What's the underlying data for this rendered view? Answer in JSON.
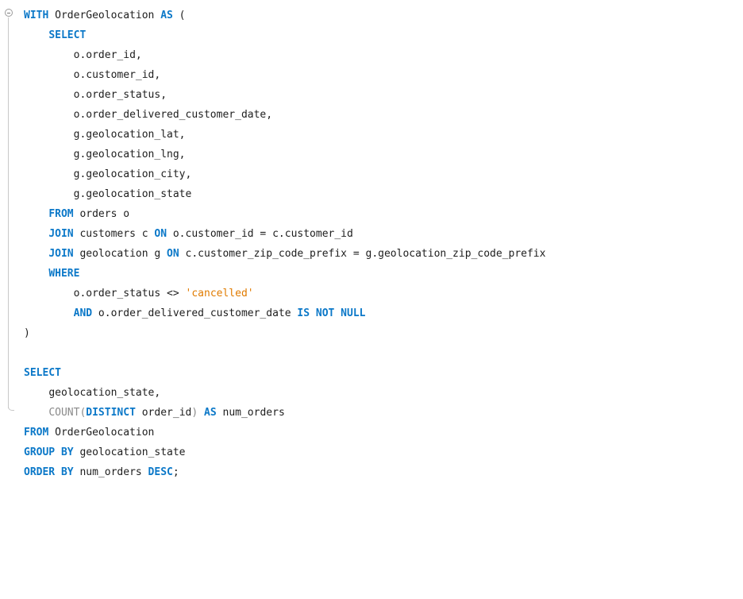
{
  "editor": {
    "cte_fold_icon": "collapse-minus-icon",
    "lines": [
      {
        "indent": "",
        "tokens": [
          {
            "t": "WITH",
            "c": "kw"
          },
          {
            "t": " OrderGeolocation ",
            "c": "ident"
          },
          {
            "t": "AS",
            "c": "kw"
          },
          {
            "t": " (",
            "c": "ident"
          }
        ]
      },
      {
        "indent": "    ",
        "tokens": [
          {
            "t": "SELECT",
            "c": "kw"
          }
        ]
      },
      {
        "indent": "        ",
        "tokens": [
          {
            "t": "o.order_id,",
            "c": "ident"
          }
        ]
      },
      {
        "indent": "        ",
        "tokens": [
          {
            "t": "o.customer_id,",
            "c": "ident"
          }
        ]
      },
      {
        "indent": "        ",
        "tokens": [
          {
            "t": "o.order_status,",
            "c": "ident"
          }
        ]
      },
      {
        "indent": "        ",
        "tokens": [
          {
            "t": "o.order_delivered_customer_date,",
            "c": "ident"
          }
        ]
      },
      {
        "indent": "        ",
        "tokens": [
          {
            "t": "g.geolocation_lat,",
            "c": "ident"
          }
        ]
      },
      {
        "indent": "        ",
        "tokens": [
          {
            "t": "g.geolocation_lng,",
            "c": "ident"
          }
        ]
      },
      {
        "indent": "        ",
        "tokens": [
          {
            "t": "g.geolocation_city,",
            "c": "ident"
          }
        ]
      },
      {
        "indent": "        ",
        "tokens": [
          {
            "t": "g.geolocation_state",
            "c": "ident"
          }
        ]
      },
      {
        "indent": "    ",
        "tokens": [
          {
            "t": "FROM",
            "c": "kw"
          },
          {
            "t": " orders o",
            "c": "ident"
          }
        ]
      },
      {
        "indent": "    ",
        "tokens": [
          {
            "t": "JOIN",
            "c": "kw"
          },
          {
            "t": " customers c ",
            "c": "ident"
          },
          {
            "t": "ON",
            "c": "kw"
          },
          {
            "t": " o.customer_id = c.customer_id",
            "c": "ident"
          }
        ]
      },
      {
        "indent": "    ",
        "tokens": [
          {
            "t": "JOIN",
            "c": "kw"
          },
          {
            "t": " geolocation g ",
            "c": "ident"
          },
          {
            "t": "ON",
            "c": "kw"
          },
          {
            "t": " c.customer_zip_code_prefix = g.geolocation_zip_code_prefix",
            "c": "ident"
          }
        ]
      },
      {
        "indent": "    ",
        "tokens": [
          {
            "t": "WHERE",
            "c": "kw"
          }
        ]
      },
      {
        "indent": "        ",
        "tokens": [
          {
            "t": "o.order_status <> ",
            "c": "ident"
          },
          {
            "t": "'cancelled'",
            "c": "str"
          }
        ]
      },
      {
        "indent": "        ",
        "tokens": [
          {
            "t": "AND",
            "c": "kw"
          },
          {
            "t": " o.order_delivered_customer_date ",
            "c": "ident"
          },
          {
            "t": "IS NOT NULL",
            "c": "kw"
          }
        ]
      },
      {
        "indent": "",
        "tokens": [
          {
            "t": ")",
            "c": "ident"
          }
        ]
      },
      {
        "indent": "",
        "tokens": []
      },
      {
        "indent": "",
        "tokens": [
          {
            "t": "SELECT",
            "c": "kw"
          }
        ]
      },
      {
        "indent": "    ",
        "tokens": [
          {
            "t": "geolocation_state,",
            "c": "ident"
          }
        ]
      },
      {
        "indent": "    ",
        "tokens": [
          {
            "t": "COUNT(",
            "c": "fn"
          },
          {
            "t": "DISTINCT",
            "c": "kw"
          },
          {
            "t": " order_id",
            "c": "ident"
          },
          {
            "t": ")",
            "c": "fn"
          },
          {
            "t": " ",
            "c": "ident"
          },
          {
            "t": "AS",
            "c": "kw"
          },
          {
            "t": " num_orders",
            "c": "ident"
          }
        ]
      },
      {
        "indent": "",
        "tokens": [
          {
            "t": "FROM",
            "c": "kw"
          },
          {
            "t": " OrderGeolocation",
            "c": "ident"
          }
        ]
      },
      {
        "indent": "",
        "tokens": [
          {
            "t": "GROUP BY",
            "c": "kw"
          },
          {
            "t": " geolocation_state",
            "c": "ident"
          }
        ]
      },
      {
        "indent": "",
        "tokens": [
          {
            "t": "ORDER BY",
            "c": "kw"
          },
          {
            "t": " num_orders ",
            "c": "ident"
          },
          {
            "t": "DESC",
            "c": "kw"
          },
          {
            "t": ";",
            "c": "ident"
          }
        ]
      }
    ]
  }
}
